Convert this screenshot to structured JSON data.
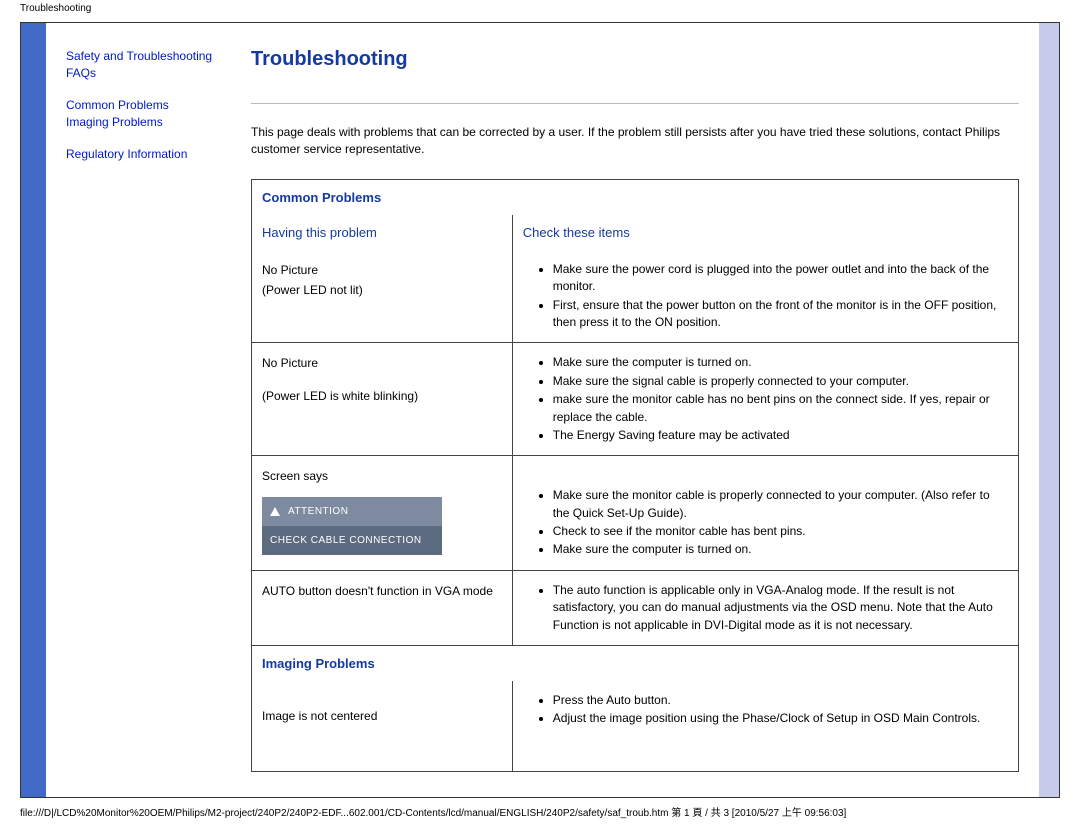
{
  "page_label": "Troubleshooting",
  "title": "Troubleshooting",
  "sidebar": {
    "links": [
      "Safety and Troubleshooting",
      "FAQs",
      "Common Problems",
      "Imaging Problems",
      "Regulatory Information"
    ]
  },
  "intro": "This page deals with problems that can be corrected by a user. If the problem still persists after you have tried these solutions, contact Philips customer service representative.",
  "section1": "Common Problems",
  "col_problem": "Having this problem",
  "col_check": "Check these items",
  "rows": [
    {
      "problem_l1": "No Picture",
      "problem_l2": "(Power LED not lit)",
      "checks": [
        "Make sure the power cord is plugged into the power outlet and into the back of the monitor.",
        "First, ensure that the power button on the front of the monitor is in the OFF position, then press it to the ON position."
      ]
    },
    {
      "problem_l1": "No Picture",
      "problem_l2": "(Power LED is white blinking)",
      "checks": [
        "Make sure the computer is turned on.",
        "Make sure the signal cable is properly connected to your computer.",
        "make sure the monitor cable has no bent pins on the connect side. If yes, repair or replace the cable.",
        "The Energy Saving feature may be activated"
      ]
    },
    {
      "problem_l1": "Screen says",
      "attention_l1": "ATTENTION",
      "attention_l2": "CHECK CABLE CONNECTION",
      "checks": [
        "Make sure the monitor cable is properly connected to your computer. (Also refer to the Quick Set-Up Guide).",
        "Check to see if the monitor cable has bent pins.",
        "Make sure the computer is turned on."
      ]
    },
    {
      "problem_l1": "AUTO button doesn't function in VGA mode",
      "checks": [
        "The auto function is applicable only in VGA-Analog mode.  If the result is not satisfactory, you can do manual adjustments via the OSD menu.  Note that the Auto Function is not applicable in DVI-Digital mode as it is not necessary."
      ]
    }
  ],
  "section2": "Imaging Problems",
  "rows2": [
    {
      "problem_l1": "Image is not centered",
      "checks": [
        "Press the Auto button.",
        "Adjust the image position using the Phase/Clock of Setup in OSD Main Controls."
      ]
    }
  ],
  "footer": "file:///D|/LCD%20Monitor%20OEM/Philips/M2-project/240P2/240P2-EDF...602.001/CD-Contents/lcd/manual/ENGLISH/240P2/safety/saf_troub.htm 第 1 頁 / 共 3  [2010/5/27 上午 09:56:03]"
}
